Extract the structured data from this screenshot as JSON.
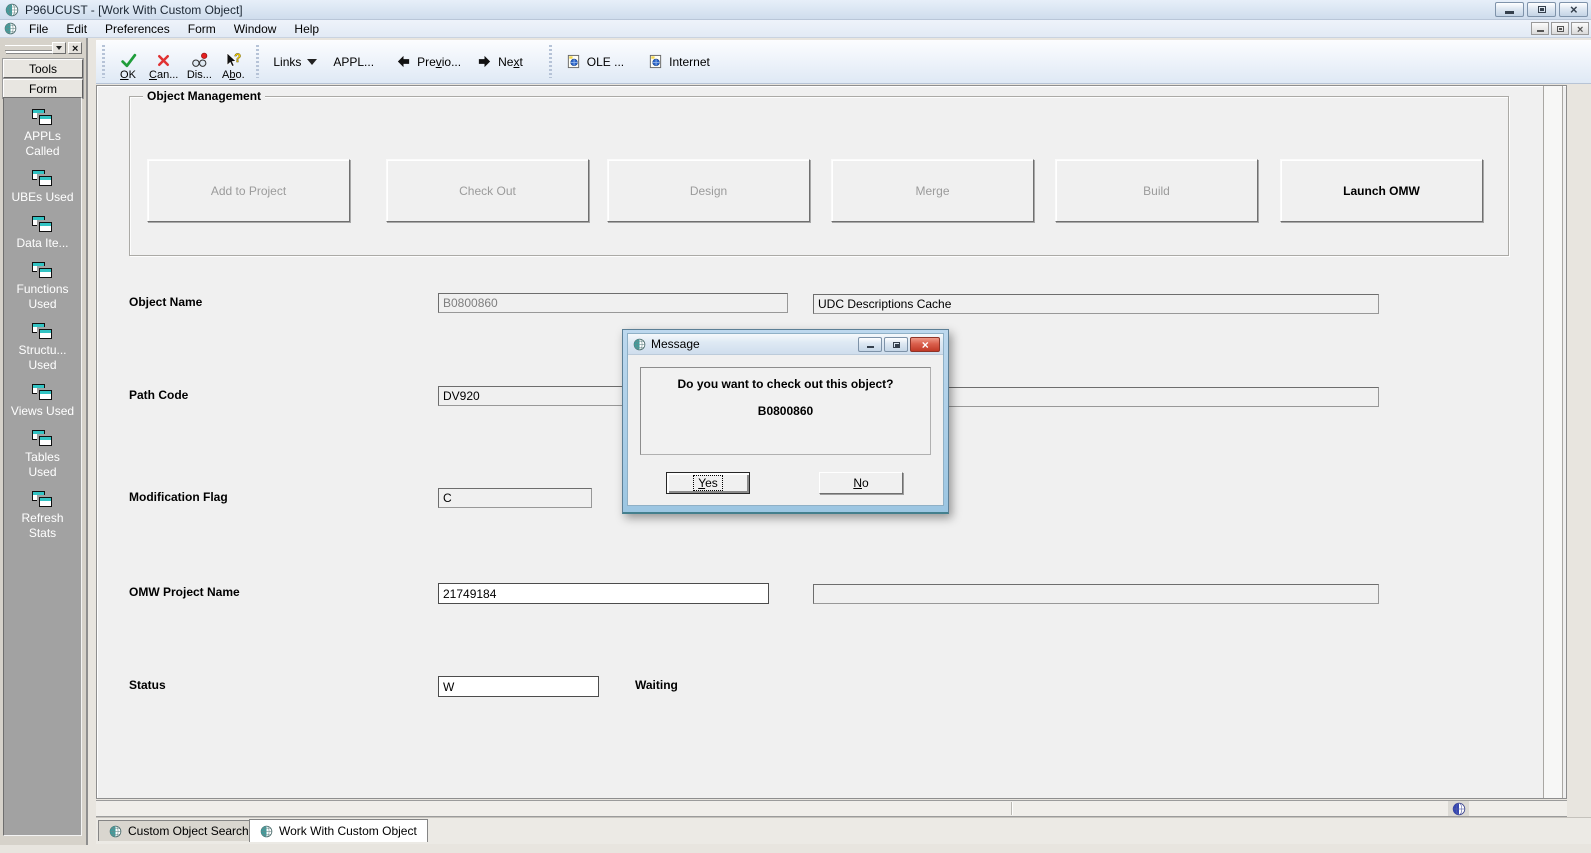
{
  "window": {
    "title": "P96UCUST - [Work With Custom Object]"
  },
  "menu": {
    "items": [
      "File",
      "Edit",
      "Preferences",
      "Form",
      "Window",
      "Help"
    ]
  },
  "toolbar": {
    "ok": {
      "pre": "",
      "key": "O",
      "post": "K"
    },
    "cancel": {
      "pre": "",
      "key": "C",
      "post": "an..."
    },
    "disable": {
      "pre": "Dis...",
      "key": "",
      "post": ""
    },
    "about": {
      "pre": "A",
      "key": "b",
      "post": "o."
    },
    "links": "Links",
    "appl": "APPL...",
    "previous": {
      "pre": "Pre",
      "key": "v",
      "post": "io..."
    },
    "next": {
      "pre": "Ne",
      "key": "x",
      "post": "t"
    },
    "ole": "OLE ...",
    "internet": "Internet"
  },
  "sidebar": {
    "tabs": [
      "Tools",
      "Form"
    ],
    "items": [
      "APPLs Called",
      "UBEs Used",
      "Data Ite...",
      "Functions Used",
      "Structu... Used",
      "Views Used",
      "Tables Used",
      "Refresh Stats"
    ]
  },
  "object_management": {
    "title": "Object Management",
    "buttons": [
      {
        "label": "Add to Project",
        "enabled": false
      },
      {
        "label": "Check Out",
        "enabled": false
      },
      {
        "label": "Design",
        "enabled": false
      },
      {
        "label": "Merge",
        "enabled": false
      },
      {
        "label": "Build",
        "enabled": false
      },
      {
        "label": "Launch OMW",
        "enabled": true
      }
    ]
  },
  "form": {
    "object_name": {
      "label": "Object Name",
      "value": "B0800860",
      "description": "UDC Descriptions Cache"
    },
    "path_code": {
      "label": "Path Code",
      "value": "DV920",
      "description": ""
    },
    "modification_flag": {
      "label": "Modification Flag",
      "value": "C"
    },
    "omw_project_name": {
      "label": "OMW Project Name",
      "value": "21749184",
      "description": ""
    },
    "status": {
      "label": "Status",
      "value": "W",
      "text": "Waiting"
    }
  },
  "dialog": {
    "title": "Message",
    "line1": "Do you want to check out this object?",
    "line2": "B0800860",
    "yes": {
      "pre": "",
      "key": "Y",
      "post": "es"
    },
    "no": {
      "pre": "",
      "key": "N",
      "post": "o"
    }
  },
  "bottom_tabs": [
    {
      "label": "Custom Object Search"
    },
    {
      "label": "Work With Custom Object"
    }
  ],
  "colors": {
    "titlebar": "#dce7f3",
    "toolbar": "#e4edf7",
    "sidebar_panel": "#a2a2a2",
    "form_bg": "#f0f0f0",
    "icon_teal": "#32c3c3",
    "check_green": "#1f9d3a",
    "cancel_red": "#e03232",
    "close_red": "#c23a28"
  }
}
